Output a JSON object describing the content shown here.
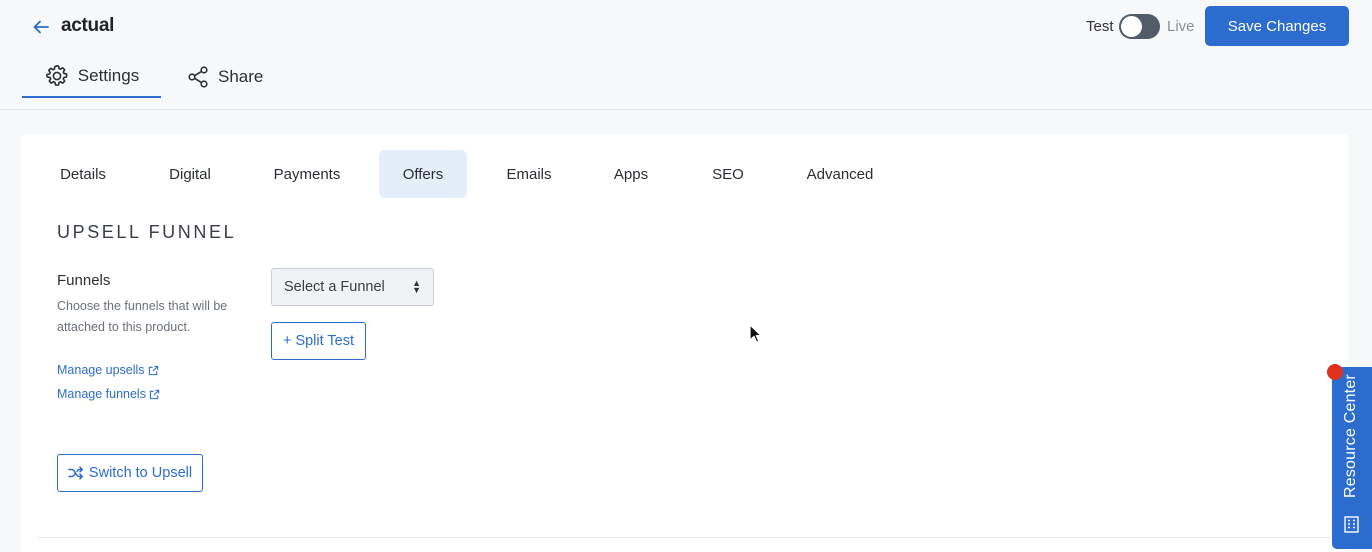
{
  "header": {
    "title": "actual",
    "mode_test": "Test",
    "mode_live": "Live",
    "save_label": "Save Changes"
  },
  "main_tabs": [
    {
      "label": "Settings",
      "icon": "gear-icon",
      "active": true
    },
    {
      "label": "Share",
      "icon": "share-icon",
      "active": false
    }
  ],
  "sub_tabs": [
    {
      "label": "Details"
    },
    {
      "label": "Digital"
    },
    {
      "label": "Payments"
    },
    {
      "label": "Offers",
      "active": true
    },
    {
      "label": "Emails"
    },
    {
      "label": "Apps"
    },
    {
      "label": "SEO"
    },
    {
      "label": "Advanced"
    }
  ],
  "upsell": {
    "section_title": "UPSELL FUNNEL",
    "field_label": "Funnels",
    "field_help": "Choose the funnels that will be attached to this product.",
    "manage_upsells": "Manage upsells",
    "manage_funnels": "Manage funnels",
    "select_value": "Select a Funnel",
    "split_test": "+ Split Test",
    "switch_label": "Switch to Upsell"
  },
  "resource_center": {
    "label": "Resource Center"
  },
  "colors": {
    "accent": "#2d6ccf",
    "active_tab_bg": "#e3eef9",
    "notification": "#e0301e"
  }
}
